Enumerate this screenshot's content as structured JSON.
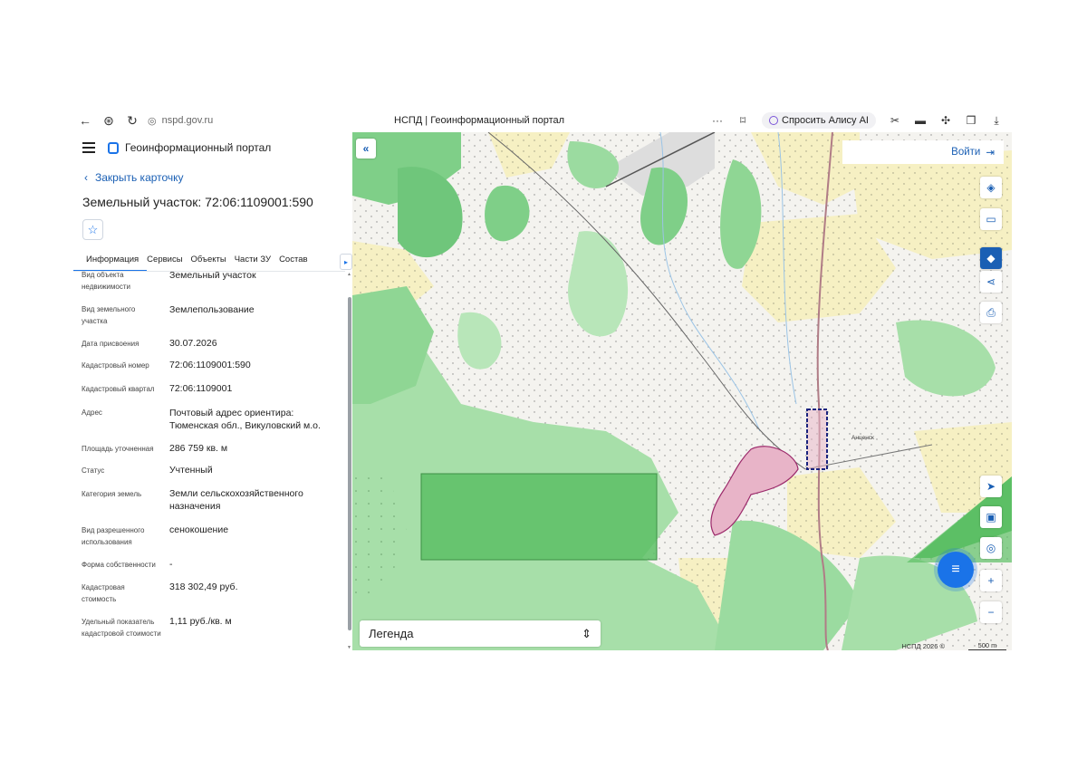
{
  "browser": {
    "url": "nspd.gov.ru",
    "tab_title": "НСПД | Геоинформационный портал",
    "alice_label": "Спросить Алису AI"
  },
  "header": {
    "portal_name": "Геоинформационный портал"
  },
  "card": {
    "close_label": "Закрыть карточку",
    "title": "Земельный участок: 72:06:1109001:590"
  },
  "tabs": [
    {
      "label": "Информация",
      "active": true
    },
    {
      "label": "Сервисы"
    },
    {
      "label": "Объекты"
    },
    {
      "label": "Части ЗУ"
    },
    {
      "label": "Состав"
    }
  ],
  "attributes": [
    {
      "label": "Вид объекта недвижимости",
      "value": "Земельный участок"
    },
    {
      "label": "Вид земельного участка",
      "value": "Землепользование"
    },
    {
      "label": "Дата присвоения",
      "value": "30.07.2026"
    },
    {
      "label": "Кадастровый номер",
      "value": "72:06:1109001:590"
    },
    {
      "label": "Кадастровый квартал",
      "value": "72:06:1109001"
    },
    {
      "label": "Адрес",
      "value": "Почтовый адрес ориентира: Тюменская обл., Викуловский м.о."
    },
    {
      "label": "Площадь уточненная",
      "value": "286 759 кв. м"
    },
    {
      "label": "Статус",
      "value": "Учтенный"
    },
    {
      "label": "Категория земель",
      "value": "Земли сельскохозяйственного назначения"
    },
    {
      "label": "Вид разрешенного использования",
      "value": "сенокошение"
    },
    {
      "label": "Форма собственности",
      "value": "-"
    },
    {
      "label": "Кадастровая стоимость",
      "value": "318 302,49 руб."
    },
    {
      "label": "Удельный показатель кадастровой стоимости",
      "value": "1,11 руб./кв. м"
    }
  ],
  "map": {
    "login_label": "Войти",
    "legend_label": "Легенда",
    "attribution": "НСПД 2026 ©",
    "scale_label": "500 m",
    "place_label": "Анценск",
    "colors": {
      "forest": "#8fd694",
      "forest_dark": "#5cbf65",
      "field": "#f6f0c3",
      "parcel": "#2e9e44",
      "settlement": "#e8b4c8",
      "selection": "#1a237e",
      "accent": "#1a73e8"
    }
  }
}
